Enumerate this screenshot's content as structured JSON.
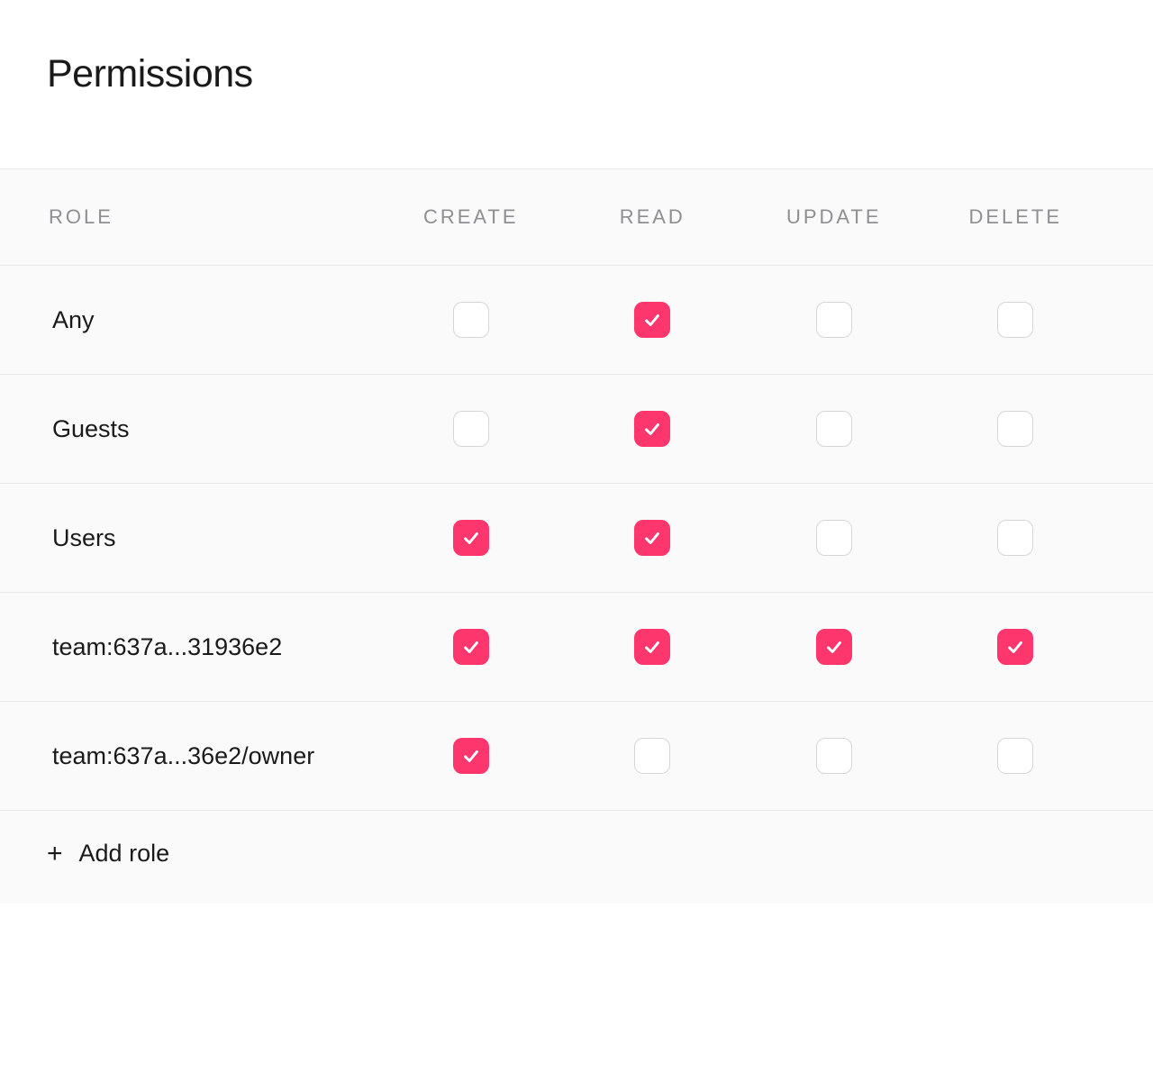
{
  "title": "Permissions",
  "columns": {
    "role": "Role",
    "create": "Create",
    "read": "Read",
    "update": "Update",
    "delete": "Delete"
  },
  "rows": [
    {
      "role": "Any",
      "create": false,
      "read": true,
      "update": false,
      "delete": false
    },
    {
      "role": "Guests",
      "create": false,
      "read": true,
      "update": false,
      "delete": false
    },
    {
      "role": "Users",
      "create": true,
      "read": true,
      "update": false,
      "delete": false
    },
    {
      "role": "team:637a...31936e2",
      "create": true,
      "read": true,
      "update": true,
      "delete": true
    },
    {
      "role": "team:637a...36e2/owner",
      "create": true,
      "read": false,
      "update": false,
      "delete": false
    }
  ],
  "add_role_label": "Add role",
  "accent_color": "#fd366e"
}
